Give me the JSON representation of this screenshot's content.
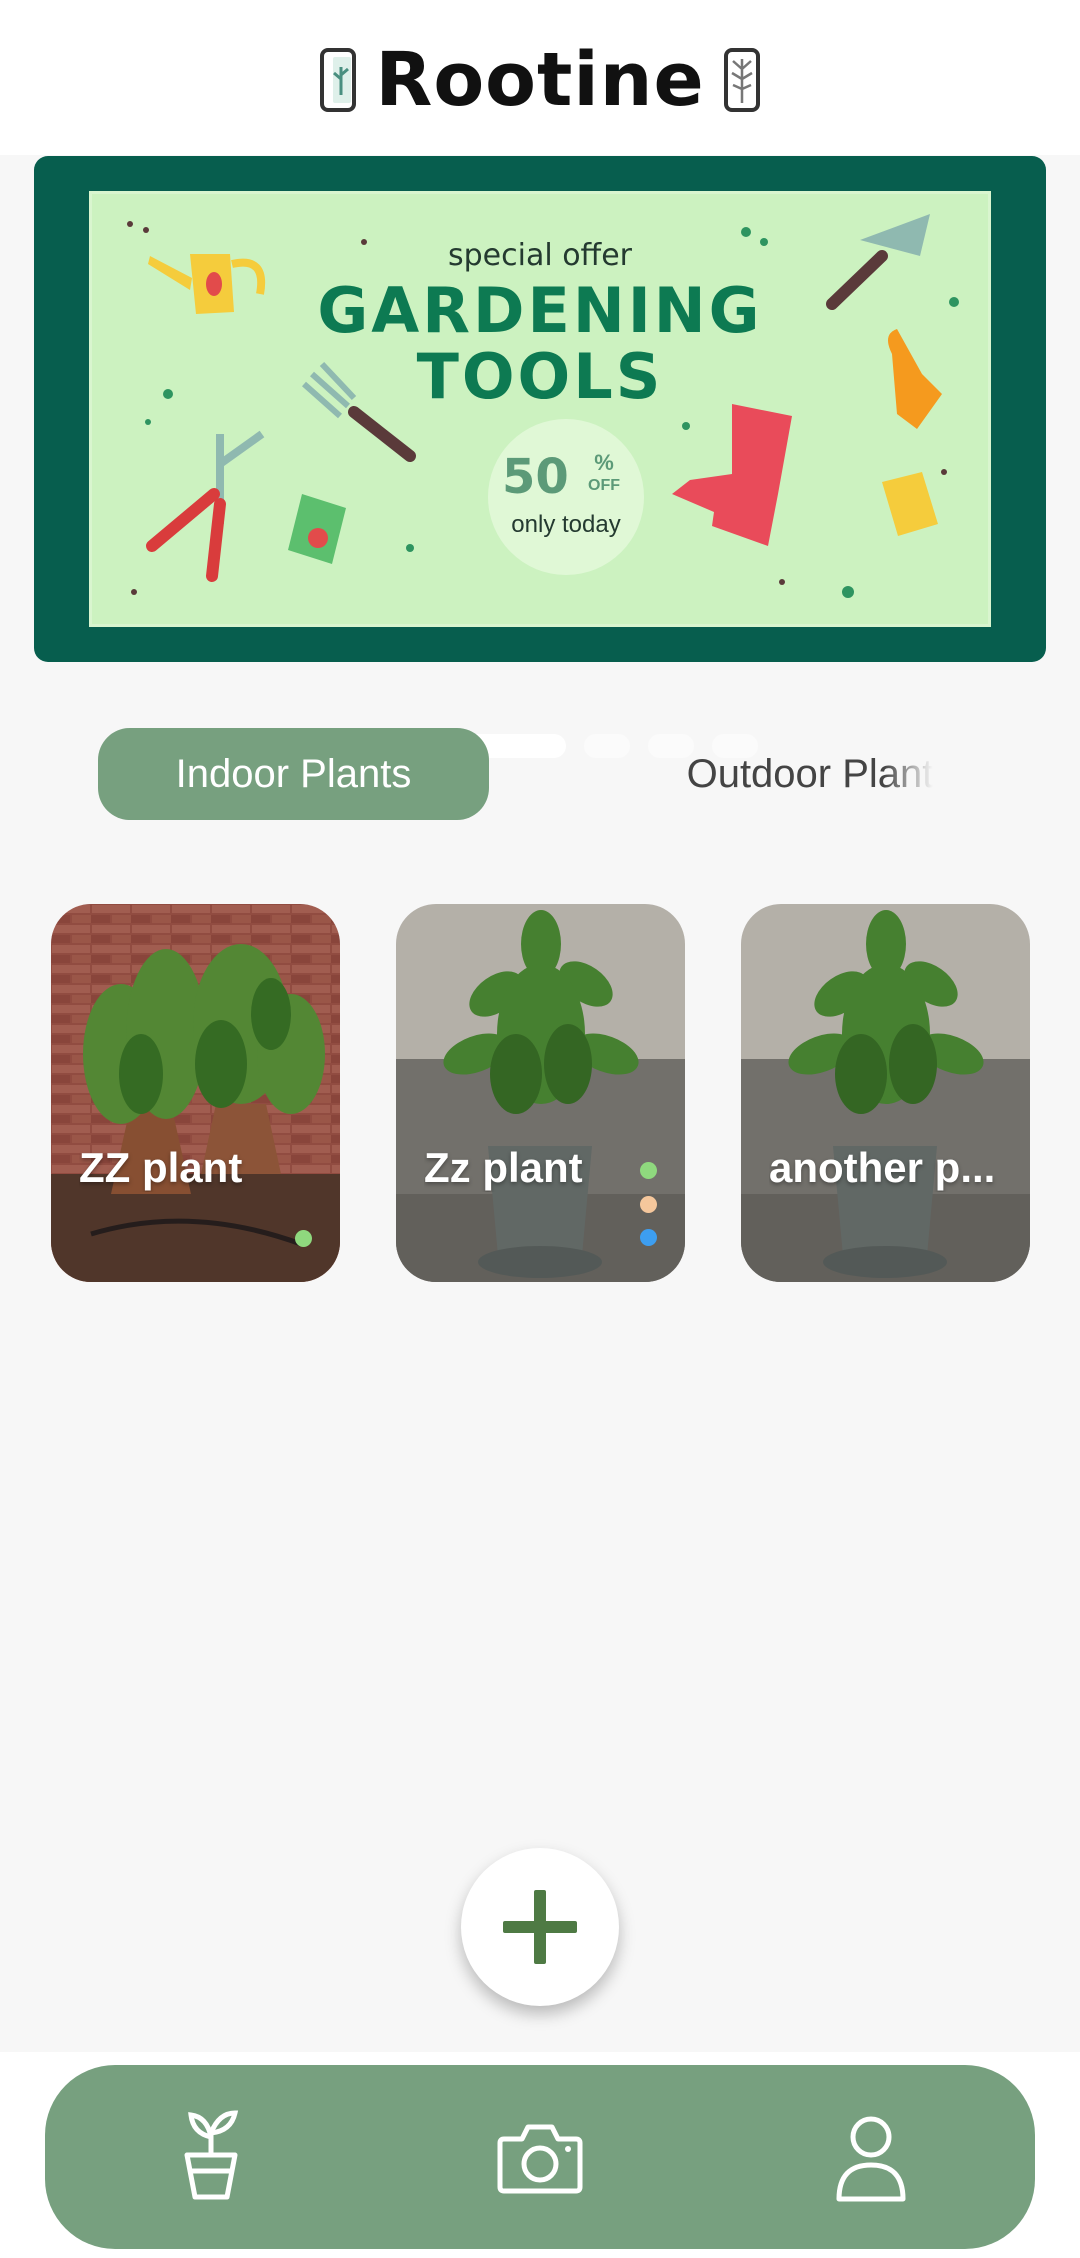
{
  "app": {
    "title": "Rootine",
    "logo_icons": [
      "left-leaf-card-icon",
      "right-tree-card-icon"
    ]
  },
  "banner": {
    "subtitle": "special offer",
    "title_line1": "GARDENING",
    "title_line2": "TOOLS",
    "discount": "50",
    "discount_unit": "%",
    "discount_suffix": "OFF",
    "discount_note": "only today",
    "slides_count": 5,
    "active_slide": 2
  },
  "tabs": [
    {
      "label": "Indoor Plants",
      "active": true
    },
    {
      "label": "Outdoor Plant",
      "active": false
    }
  ],
  "plants": [
    {
      "name": "ZZ plant",
      "dots": [
        "#8fd97e"
      ]
    },
    {
      "name": "Zz plant",
      "dots": [
        "#8fd97e",
        "#f5c79c",
        "#3d9ef0"
      ]
    },
    {
      "name": "another p...",
      "dots": []
    }
  ],
  "fab": {
    "icon": "plus-icon"
  },
  "bottom_nav": [
    {
      "icon": "plant-pot-icon"
    },
    {
      "icon": "camera-icon"
    },
    {
      "icon": "user-icon"
    }
  ],
  "colors": {
    "accent": "#77a07f",
    "banner_frame": "#075e4e",
    "banner_bg": "#ccf2c0",
    "fab_plus": "#4e7a44"
  }
}
